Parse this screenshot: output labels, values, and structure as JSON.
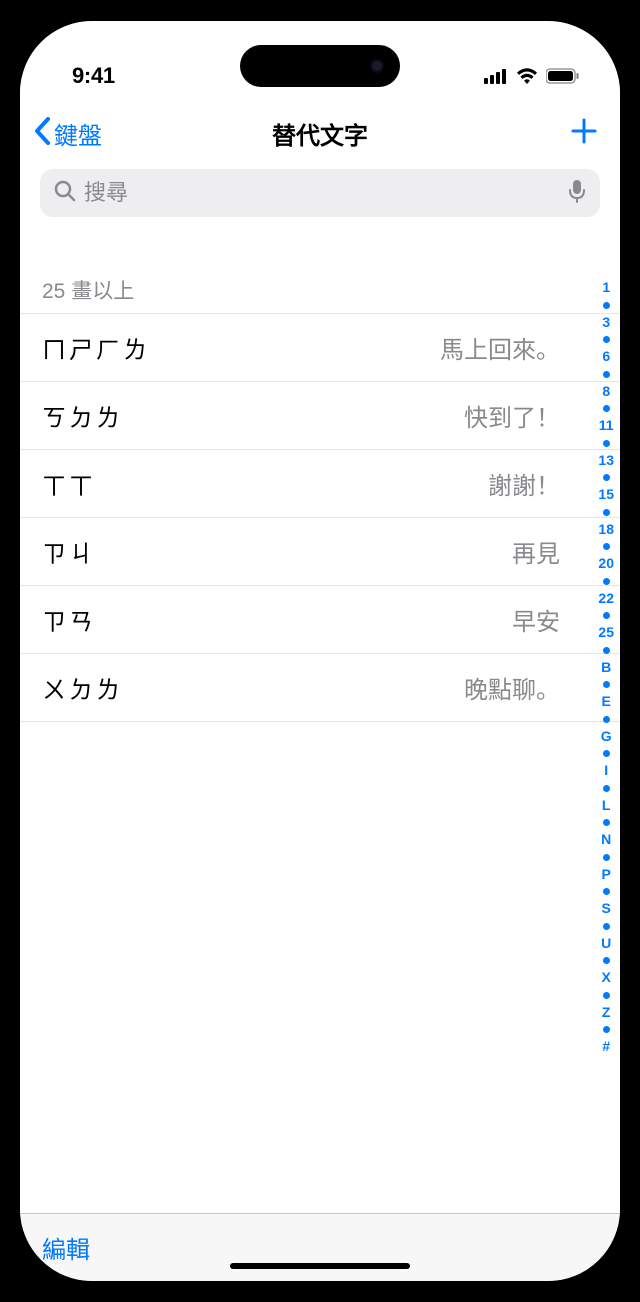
{
  "status": {
    "time": "9:41"
  },
  "nav": {
    "back_label": "鍵盤",
    "title": "替代文字"
  },
  "search": {
    "placeholder": "搜尋"
  },
  "section_header": "25 畫以上",
  "shortcuts": [
    {
      "key": "ㄇㄕㄏㄌ",
      "value": "馬上回來。"
    },
    {
      "key": "ㄎㄉㄌ",
      "value": "快到了！"
    },
    {
      "key": "ㄒㄒ",
      "value": "謝謝！"
    },
    {
      "key": "ㄗㄐ",
      "value": "再見"
    },
    {
      "key": "ㄗㄢ",
      "value": "早安"
    },
    {
      "key": "ㄨㄉㄌ",
      "value": "晚點聊。"
    }
  ],
  "index_labels": [
    "1",
    "3",
    "6",
    "8",
    "11",
    "13",
    "15",
    "18",
    "20",
    "22",
    "25",
    "B",
    "E",
    "G",
    "I",
    "L",
    "N",
    "P",
    "S",
    "U",
    "X",
    "Z",
    "#"
  ],
  "toolbar": {
    "edit_label": "編輯"
  }
}
